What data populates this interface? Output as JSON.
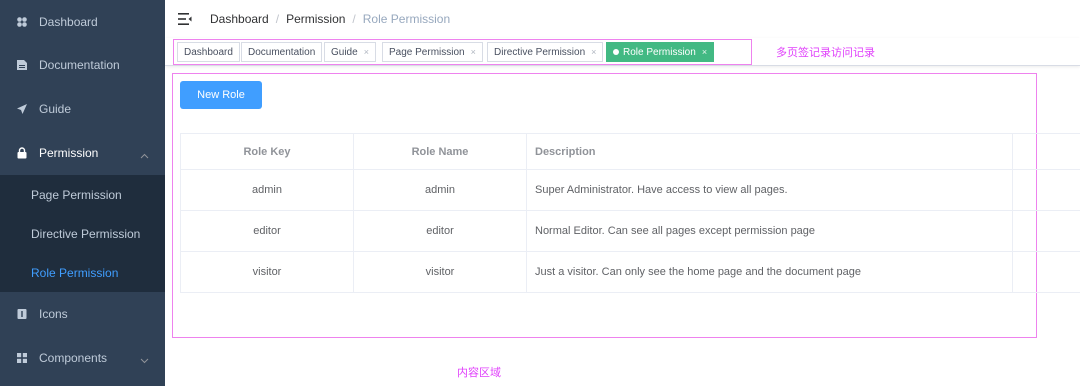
{
  "sidebar": {
    "items": [
      {
        "label": "Dashboard",
        "icon": "dashboard-icon"
      },
      {
        "label": "Documentation",
        "icon": "documentation-icon"
      },
      {
        "label": "Guide",
        "icon": "guide-icon"
      },
      {
        "label": "Permission",
        "icon": "lock-icon",
        "expanded": true
      },
      {
        "label": "Icons",
        "icon": "icons-icon"
      },
      {
        "label": "Components",
        "icon": "components-icon"
      }
    ],
    "submenu": [
      {
        "label": "Page Permission"
      },
      {
        "label": "Directive Permission"
      },
      {
        "label": "Role Permission",
        "active": true
      }
    ],
    "active_color": "#409eff",
    "bg_color": "#304156"
  },
  "breadcrumb": [
    "Dashboard",
    "Permission",
    "Role Permission"
  ],
  "tags": [
    {
      "label": "Dashboard",
      "closable": false
    },
    {
      "label": "Documentation",
      "closable": false
    },
    {
      "label": "Guide",
      "closable": true
    },
    {
      "label": "Page Permission",
      "closable": true
    },
    {
      "label": "Directive Permission",
      "closable": true
    },
    {
      "label": "Role Permission",
      "closable": true,
      "active": true
    }
  ],
  "tag_close_glyph": "×",
  "tag_active_color": "#42b983",
  "annotations": {
    "tags_view": "多页签记录访问记录",
    "content": "内容区域"
  },
  "content": {
    "new_role_button": "New Role",
    "table": {
      "headers": [
        "Role Key",
        "Role Name",
        "Description"
      ],
      "rows": [
        [
          "admin",
          "admin",
          "Super Administrator. Have access to view all pages."
        ],
        [
          "editor",
          "editor",
          "Normal Editor. Can see all pages except permission page"
        ],
        [
          "visitor",
          "visitor",
          "Just a visitor. Can only see the home page and the document page"
        ]
      ]
    }
  }
}
